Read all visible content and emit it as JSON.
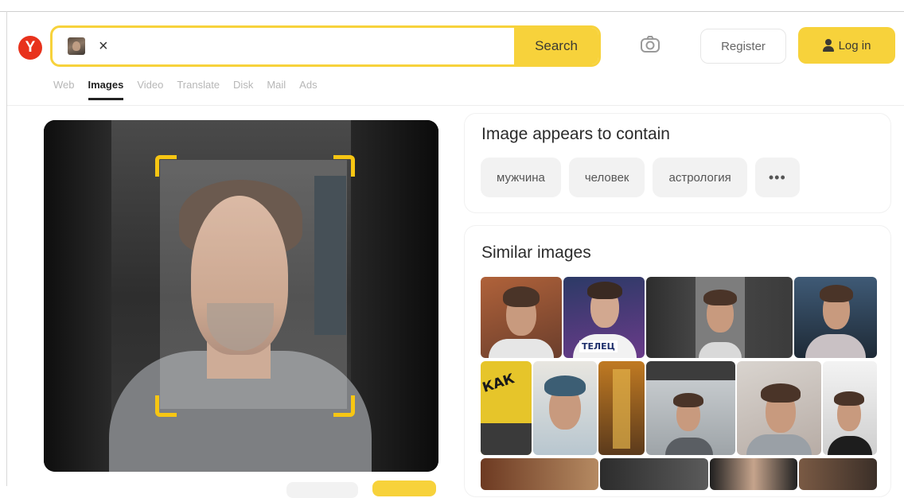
{
  "logo": {
    "letter": "Y"
  },
  "search": {
    "clear_symbol": "×",
    "button_label": "Search",
    "value": ""
  },
  "header": {
    "register_label": "Register",
    "login_label": "Log in"
  },
  "tabs": [
    {
      "label": "Web",
      "active": false
    },
    {
      "label": "Images",
      "active": true
    },
    {
      "label": "Video",
      "active": false
    },
    {
      "label": "Translate",
      "active": false
    },
    {
      "label": "Disk",
      "active": false
    },
    {
      "label": "Mail",
      "active": false
    },
    {
      "label": "Ads",
      "active": false
    }
  ],
  "contains": {
    "title": "Image appears to contain",
    "tags": [
      "мужчина",
      "человек",
      "астрология"
    ],
    "more_label": "•••"
  },
  "similar": {
    "title": "Similar images",
    "banner_texts": [
      "ТЕЛЕЦ",
      "КАК"
    ]
  },
  "colors": {
    "accent_yellow": "#f7d23b",
    "logo_red": "#e8321c",
    "crop_frame": "#f7c613"
  },
  "icons": [
    "camera-icon",
    "user-icon",
    "close-icon",
    "more-icon"
  ]
}
